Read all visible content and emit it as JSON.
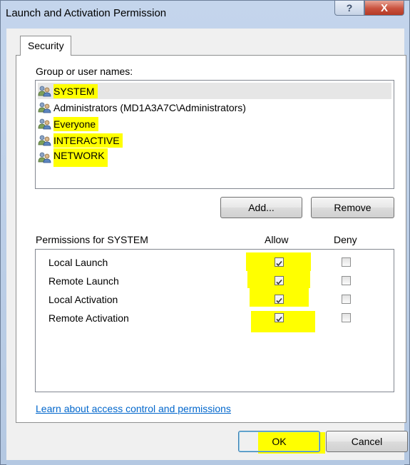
{
  "window": {
    "title": "Launch and Activation Permission",
    "help_glyph": "?",
    "close_glyph": "X"
  },
  "tabs": [
    {
      "label": "Security",
      "active": true
    }
  ],
  "group_section": {
    "label": "Group or user names:",
    "users": [
      {
        "name": "SYSTEM",
        "selected": true,
        "highlighted": true
      },
      {
        "name": "Administrators (MD1A3A7C\\Administrators)",
        "selected": false,
        "highlighted": false
      },
      {
        "name": "Everyone",
        "selected": false,
        "highlighted": true
      },
      {
        "name": "INTERACTIVE",
        "selected": false,
        "highlighted": true
      },
      {
        "name": "NETWORK",
        "selected": false,
        "highlighted": true
      }
    ],
    "add_label": "Add...",
    "remove_label": "Remove"
  },
  "permissions": {
    "label": "Permissions for SYSTEM",
    "allow_header": "Allow",
    "deny_header": "Deny",
    "rows": [
      {
        "name": "Local Launch",
        "allow": true,
        "deny": false
      },
      {
        "name": "Remote Launch",
        "allow": true,
        "deny": false
      },
      {
        "name": "Local Activation",
        "allow": true,
        "deny": false
      },
      {
        "name": "Remote Activation",
        "allow": true,
        "deny": false
      }
    ]
  },
  "footer": {
    "link_text": "Learn about access control and permissions",
    "ok_label": "OK",
    "cancel_label": "Cancel"
  },
  "colors": {
    "highlight": "#ffff00",
    "link": "#0066cc",
    "close_button": "#c9513d"
  },
  "icons": {
    "user": "users-group-icon",
    "check": "checkmark-icon"
  }
}
